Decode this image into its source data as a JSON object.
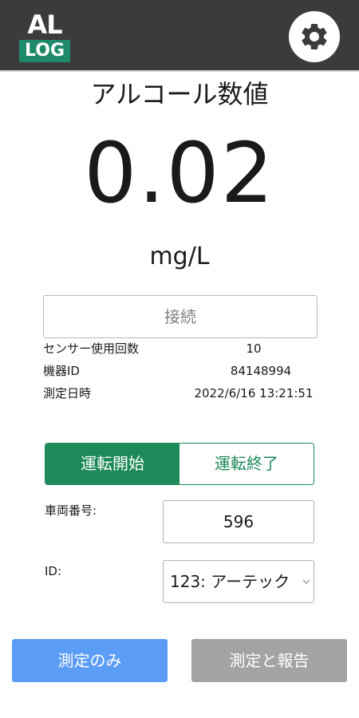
{
  "header": {
    "logo_top": "AL",
    "logo_bottom": "LOG",
    "settings_icon": "gear-icon"
  },
  "reading": {
    "title": "アルコール数値",
    "value": "0.02",
    "unit": "mg/L"
  },
  "connect_label": "接続",
  "info": {
    "sensor_count_label": "センサー使用回数",
    "sensor_count_value": "10",
    "device_id_label": "機器ID",
    "device_id_value": "84148994",
    "measured_at_label": "測定日時",
    "measured_at_value": "2022/6/16 13:21:51"
  },
  "driving": {
    "start_label": "運転開始",
    "end_label": "運転終了",
    "selected": "start"
  },
  "form": {
    "vehicle_label": "車両番号:",
    "vehicle_value": "596",
    "id_label": "ID:",
    "id_value": "123: アーテック"
  },
  "actions": {
    "measure_only": "測定のみ",
    "measure_and_report": "測定と報告"
  },
  "colors": {
    "header_bg": "#3b3b3b",
    "logo_green": "#1e8a6a",
    "accent_green": "#1e8a5a",
    "primary_blue": "#5b9cf6",
    "disabled_gray": "#a3a3a3"
  }
}
